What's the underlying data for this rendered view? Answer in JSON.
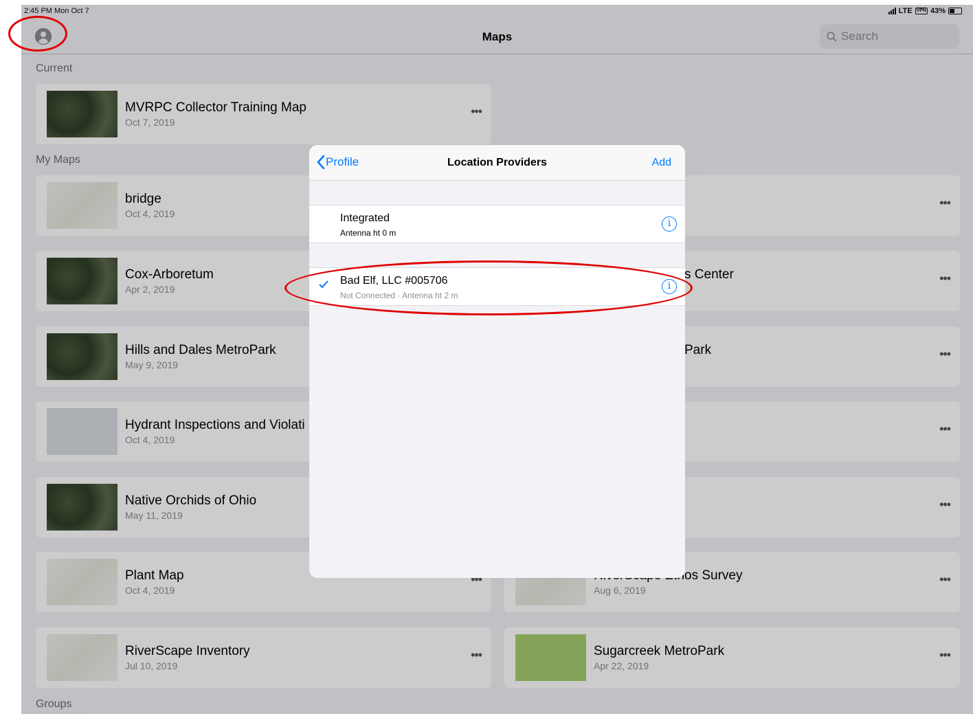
{
  "status_bar": {
    "time": "2:45 PM  Mon Oct 7",
    "network": "LTE",
    "vpn": "VPN",
    "battery": "43%"
  },
  "navbar": {
    "title": "Maps",
    "search_placeholder": "Search"
  },
  "sections": {
    "current": "Current",
    "my_maps": "My Maps",
    "groups": "Groups"
  },
  "maps": [
    {
      "title": "MVRPC Collector Training Map",
      "date": "Oct 7, 2019"
    },
    {
      "title": "bridge",
      "date": "Oct 4, 2019"
    },
    {
      "title": "Cox-Arboretum",
      "date": "Apr 2, 2019"
    },
    {
      "title": "Hills and Dales MetroPark",
      "date": "May 9, 2019"
    },
    {
      "title": "Hydrant Inspections and Violati",
      "date": "Oct 4, 2019"
    },
    {
      "title": "Native Orchids of Ohio",
      "date": "May 11, 2019"
    },
    {
      "title": "Plant Map",
      "date": "Oct 4, 2019"
    },
    {
      "title": "RiverScape Inventory",
      "date": "Jul 10, 2019"
    },
    {
      "title": "s Center",
      "date": ""
    },
    {
      "title": "Park",
      "date": ""
    },
    {
      "title": "RiverScape Ethos Survey",
      "date": "Aug 6, 2019"
    },
    {
      "title": "Sugarcreek MetroPark",
      "date": "Apr 22, 2019"
    }
  ],
  "more_label": "•••",
  "modal": {
    "back_label": "Profile",
    "title": "Location Providers",
    "add_label": "Add",
    "providers": [
      {
        "name": "Integrated",
        "detail": "Antenna ht 0 m"
      },
      {
        "name": "Bad Elf, LLC #005706",
        "detail": "Not Connected · Antenna ht 2 m",
        "selected": true
      }
    ],
    "info_glyph": "i"
  },
  "colors": {
    "accent": "#007aff",
    "annotation": "#e00000"
  }
}
